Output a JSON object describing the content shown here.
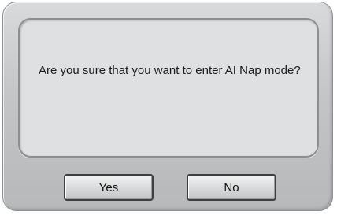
{
  "dialog": {
    "message": "Are you sure that you want to enter AI Nap mode?",
    "yes_label": "Yes",
    "no_label": "No"
  }
}
